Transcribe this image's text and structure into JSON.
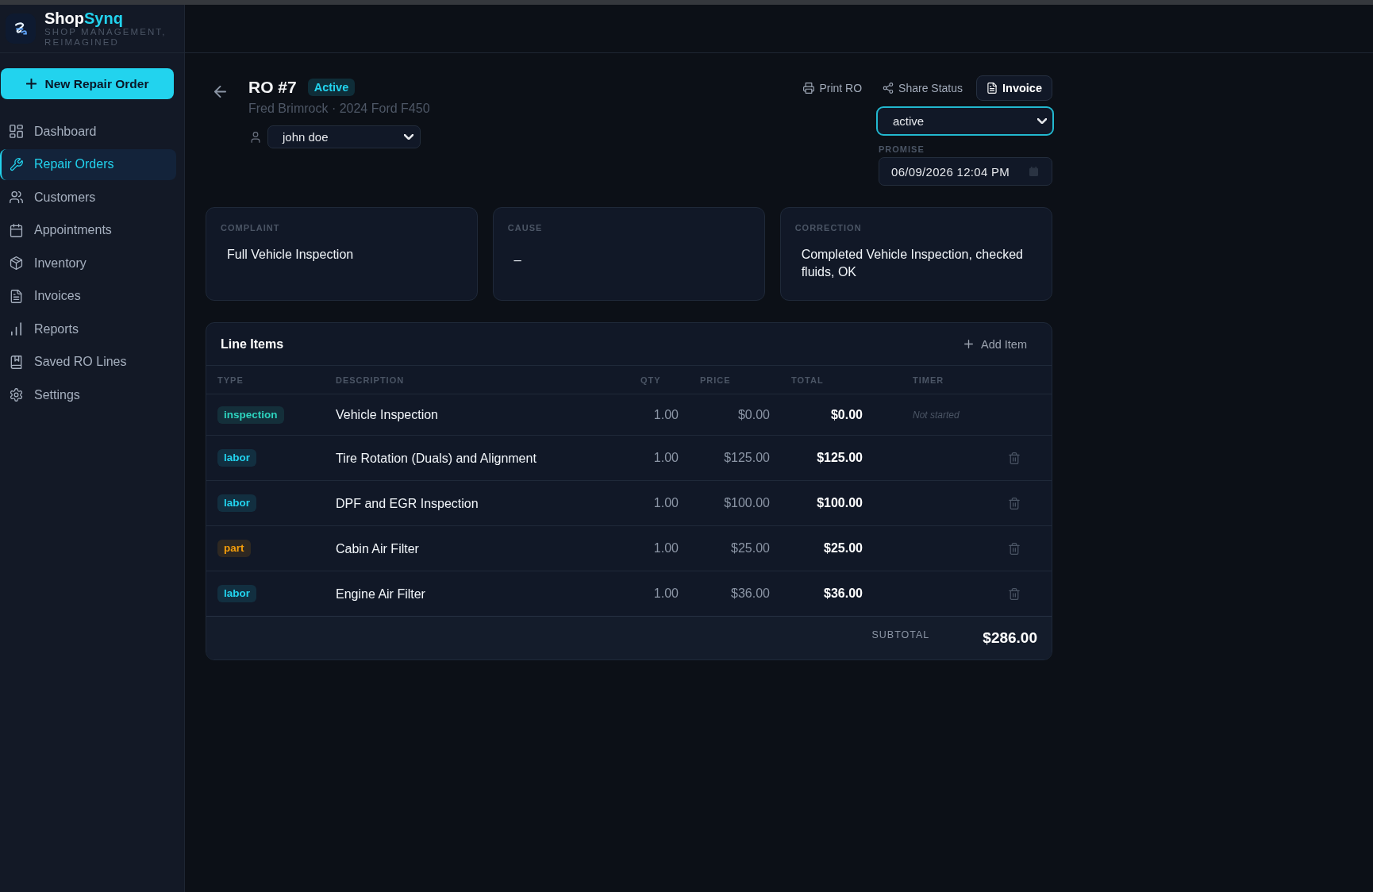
{
  "sidebar": {
    "brand": {
      "title": "Shop",
      "title_accent": "Synq",
      "tagline": "SHOP MANAGEMENT, REIMAGINED"
    },
    "new_button": "New Repair Order",
    "nav": [
      {
        "label": "Dashboard",
        "selected": false
      },
      {
        "label": "Repair Orders",
        "selected": true
      },
      {
        "label": "Customers",
        "selected": false
      },
      {
        "label": "Appointments",
        "selected": false
      },
      {
        "label": "Inventory",
        "selected": false
      },
      {
        "label": "Invoices",
        "selected": false
      },
      {
        "label": "Reports",
        "selected": false
      },
      {
        "label": "Saved RO Lines",
        "selected": false
      },
      {
        "label": "Settings",
        "selected": false
      }
    ]
  },
  "repair_order": {
    "title": "RO #7",
    "status_badge": "Active",
    "subtitle": "Fred Brimrock · 2024 Ford F450",
    "assignee": "john doe"
  },
  "actions": [
    {
      "label": "Print RO",
      "kind": "link"
    },
    {
      "label": "Share Status",
      "kind": "link"
    },
    {
      "label": "Invoice",
      "kind": "button"
    }
  ],
  "status_select": {
    "value": "active",
    "focused": true
  },
  "promise": {
    "label": "PROMISE",
    "value": "06/09/2026 12:04 PM"
  },
  "story_cards": [
    {
      "label": "COMPLAINT",
      "text": "Full Vehicle Inspection"
    },
    {
      "label": "CAUSE",
      "text": "_"
    },
    {
      "label": "CORRECTION",
      "text": "Completed Vehicle Inspection, checked fluids, OK"
    }
  ],
  "line_items": {
    "title": "Line Items",
    "add_button": "Add Item",
    "columns": [
      "TYPE",
      "DESCRIPTION",
      "QTY",
      "PRICE",
      "TOTAL",
      "TIMER"
    ],
    "rows": [
      {
        "type": "inspection",
        "color": "#2dd4bf",
        "description": "Vehicle Inspection",
        "qty": "1.00",
        "price": "$0.00",
        "total": "$0.00",
        "timer": "Not started",
        "deletable": false
      },
      {
        "type": "labor",
        "color": "#22d3ee",
        "description": "Tire Rotation (Duals) and Alignment",
        "qty": "1.00",
        "price": "$125.00",
        "total": "$125.00",
        "deletable": true
      },
      {
        "type": "labor",
        "color": "#22d3ee",
        "description": "DPF and EGR Inspection",
        "qty": "1.00",
        "price": "$100.00",
        "total": "$100.00",
        "deletable": true
      },
      {
        "type": "part",
        "color": "#f59e0b",
        "description": "Cabin Air Filter",
        "qty": "1.00",
        "price": "$25.00",
        "total": "$25.00",
        "deletable": true
      },
      {
        "type": "labor",
        "color": "#22d3ee",
        "description": "Engine Air Filter",
        "qty": "1.00",
        "price": "$36.00",
        "total": "$36.00",
        "deletable": true
      }
    ],
    "subtotal_label": "SUBTOTAL",
    "subtotal": "$286.00"
  }
}
